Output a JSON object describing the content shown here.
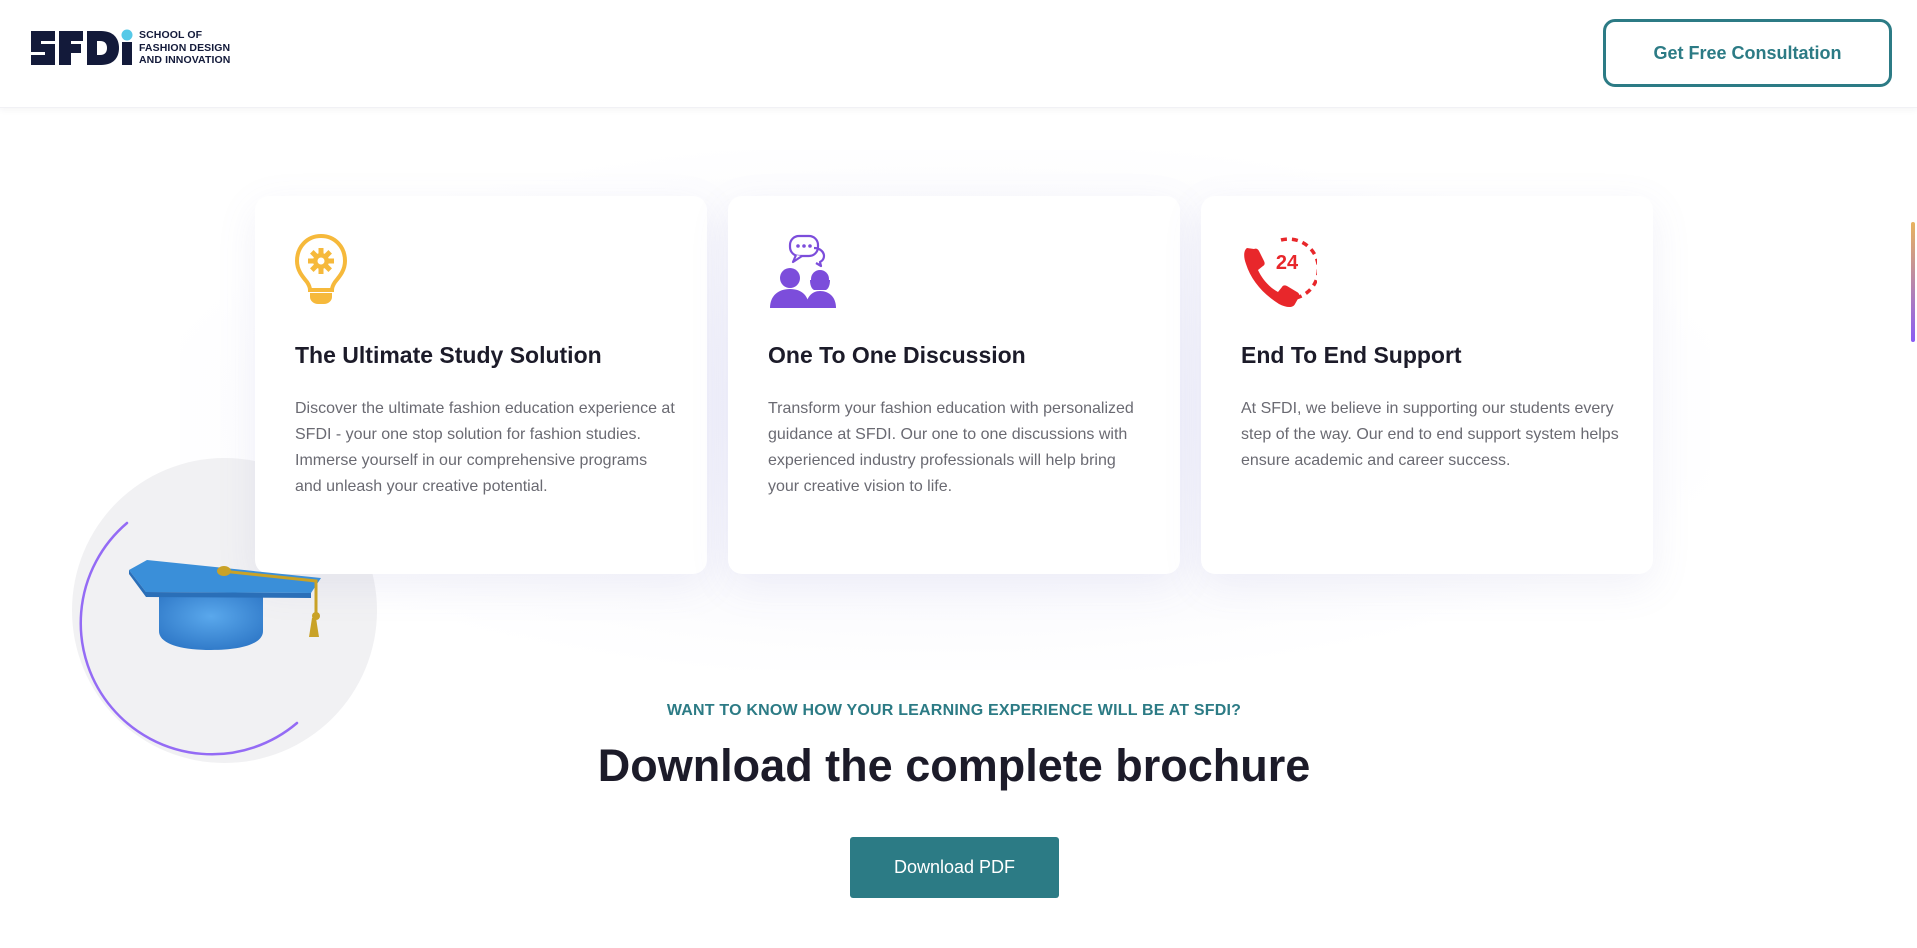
{
  "header": {
    "logo": {
      "wordmark": "SFDI",
      "lines": [
        "SCHOOL OF",
        "FASHION DESIGN",
        "AND INNOVATION"
      ]
    },
    "cta_label": "Get Free Consultation"
  },
  "features": [
    {
      "icon": "lightbulb-gear-icon",
      "title": "The Ultimate Study Solution",
      "description": "Discover the ultimate fashion education experience at SFDI - your one stop solution for fashion studies. Immerse yourself in our comprehensive programs and unleash your creative potential."
    },
    {
      "icon": "discussion-people-icon",
      "title": "One To One Discussion",
      "description": "Transform your fashion education with personalized guidance at SFDI. Our one to one discussions with experienced industry professionals will help bring your creative vision to life."
    },
    {
      "icon": "phone-24-support-icon",
      "icon_text": "24",
      "title": "End To End Support",
      "description": "At SFDI, we believe in supporting our students every step of the way. Our end to end support system helps ensure academic and career success."
    }
  ],
  "brochure": {
    "eyebrow": "WANT TO KNOW HOW YOUR LEARNING EXPERIENCE WILL BE AT SFDI?",
    "headline": "Download the complete brochure",
    "button_label": "Download PDF"
  },
  "colors": {
    "teal": "#2c7b85",
    "navy": "#131a3a",
    "amber": "#f6b93b",
    "purple": "#7c4ddb",
    "red": "#e8272b",
    "cap_blue": "#3a8fd9",
    "tassel_gold": "#c9a227"
  }
}
